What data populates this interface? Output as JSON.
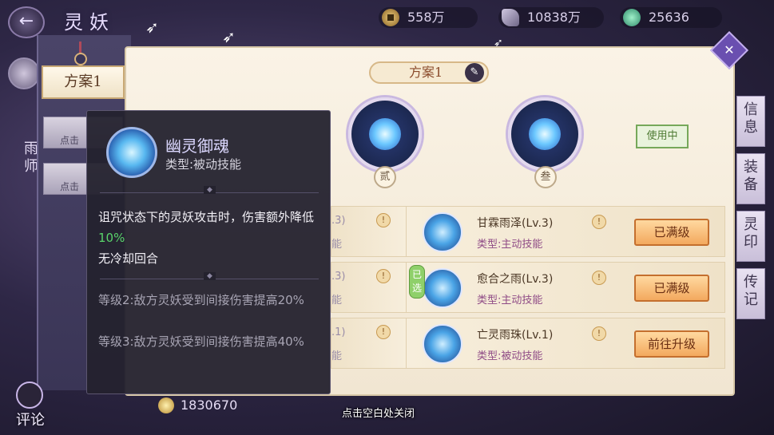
{
  "header": {
    "title": "灵妖",
    "resources": [
      {
        "icon": "copper-coin-icon",
        "value": "558万"
      },
      {
        "icon": "feather-icon",
        "value": "10838万"
      },
      {
        "icon": "jade-icon",
        "value": "25636"
      }
    ]
  },
  "plans": {
    "active_tab": "方案1",
    "other_tab_hint": "点击"
  },
  "left_edge": {
    "vertical_text": "雨师",
    "comment_label": "评论"
  },
  "scheme": {
    "title": "方案1",
    "in_use_label": "使用中",
    "orb_labels": [
      "贰",
      "叁"
    ]
  },
  "skills": [
    {
      "name": "甘霖雨泽",
      "level": "(Lv.3)",
      "type": "类型:主动技能",
      "action": "已满级",
      "selected": false
    },
    {
      "name": "愈合之雨",
      "level": "(Lv.3)",
      "type": "类型:主动技能",
      "action": "已满级",
      "selected": true
    },
    {
      "name": "亡灵雨珠",
      "level": "(Lv.1)",
      "type": "类型:被动技能",
      "action": "前往升级",
      "selected": false
    }
  ],
  "left_fragments": [
    {
      "level": ".3)",
      "type": "能"
    },
    {
      "level": ".3)",
      "type": "能"
    },
    {
      "level": ".1)",
      "type": "能"
    }
  ],
  "selected_badge": "已选",
  "side_tabs": [
    "信息",
    "装备",
    "灵印",
    "传记"
  ],
  "tooltip": {
    "name": "幽灵御魂",
    "type": "类型:被动技能",
    "desc_part1": "诅咒状态下的灵妖攻击时，伤害额外降低",
    "desc_green": "10%",
    "desc_part2": "无冷却回合",
    "level2": "等级2:敌方灵妖受到间接伤害提高20%",
    "level3": "等级3:敌方灵妖受到间接伤害提高40%"
  },
  "bottom": {
    "gold_value": "1830670",
    "close_hint": "点击空白处关闭"
  },
  "colors": {
    "accent_purple": "#6a4fb0",
    "active_skill_type": "#8f4b86",
    "highlight_green": "#59d36a",
    "action_orange": "#f3a95e"
  }
}
